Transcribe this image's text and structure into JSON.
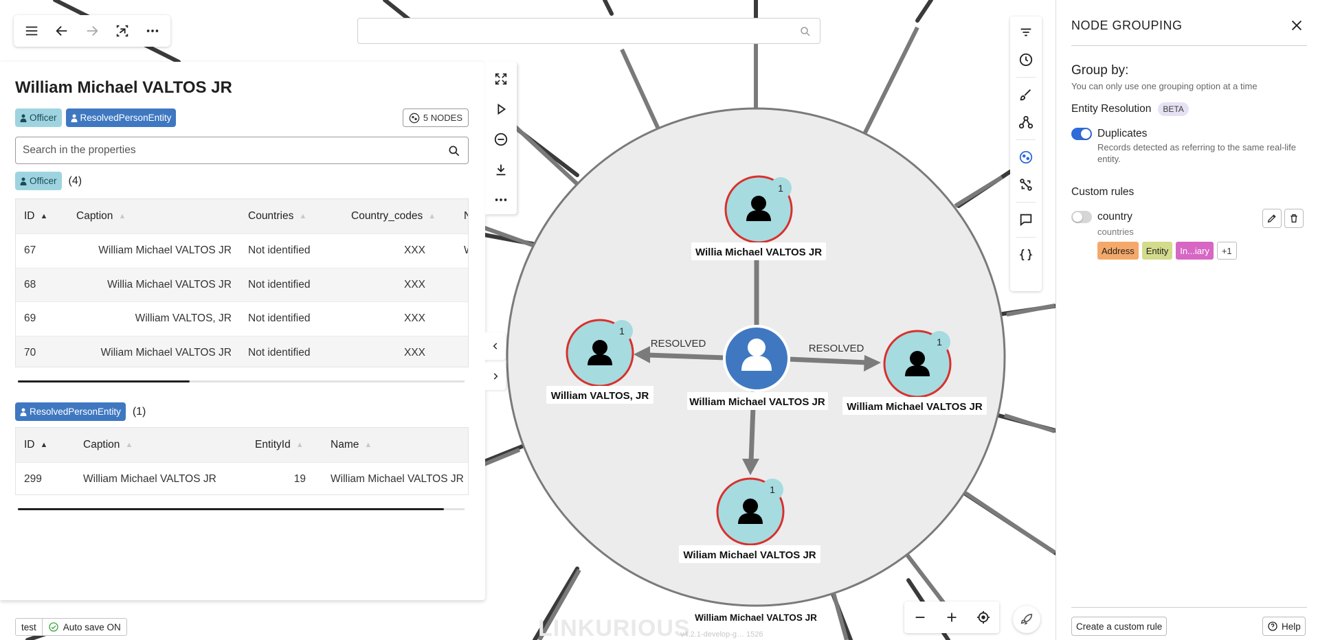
{
  "toolbar": {
    "icons": [
      "menu-icon",
      "back-arrow-icon",
      "forward-arrow-icon",
      "layout-icon",
      "more-icon"
    ]
  },
  "main_search": {
    "placeholder": ""
  },
  "left_panel": {
    "title": "William Michael VALTOS JR",
    "categories": [
      {
        "label": "Officer",
        "color": "#9ed4e0"
      },
      {
        "label": "ResolvedPersonEntity",
        "color": "#3f78c1"
      }
    ],
    "nodes_badge": "5 NODES",
    "search_placeholder": "Search in the properties",
    "officer_section": {
      "badge": "Officer",
      "count": "(4)",
      "columns": [
        "ID",
        "Caption",
        "Countries",
        "Country_codes",
        "N"
      ],
      "rows": [
        {
          "id": "67",
          "caption": "William Michael VALTOS JR",
          "countries": "Not identified",
          "country_codes": "XXX",
          "extra": "W"
        },
        {
          "id": "68",
          "caption": "Willia Michael VALTOS JR",
          "countries": "Not identified",
          "country_codes": "XXX",
          "extra": ""
        },
        {
          "id": "69",
          "caption": "William VALTOS, JR",
          "countries": "Not identified",
          "country_codes": "XXX",
          "extra": ""
        },
        {
          "id": "70",
          "caption": "Wiliam Michael VALTOS JR",
          "countries": "Not identified",
          "country_codes": "XXX",
          "extra": ""
        }
      ]
    },
    "resolved_section": {
      "badge": "ResolvedPersonEntity",
      "count": "(1)",
      "columns": [
        "ID",
        "Caption",
        "EntityId",
        "Name"
      ],
      "rows": [
        {
          "id": "299",
          "caption": "William Michael VALTOS JR",
          "entity_id": "19",
          "name": "William Michael VALTOS JR"
        }
      ]
    }
  },
  "graph": {
    "center_label": "William Michael VALTOS JR",
    "nodes": [
      {
        "label": "Willia Michael VALTOS JR",
        "badge": "1"
      },
      {
        "label": "William VALTOS, JR",
        "badge": "1"
      },
      {
        "label": "William Michael VALTOS JR",
        "badge": "1"
      },
      {
        "label": "Wiliam Michael VALTOS JR",
        "badge": "1"
      }
    ],
    "edge_labels": [
      "RESOLVED",
      "RESOLVED"
    ],
    "group_caption": "William Michael VALTOS JR",
    "node_color": "#a6dbe0",
    "center_color": "#3f78c1",
    "border_color": "#d9302c"
  },
  "right_panel": {
    "title": "NODE GROUPING",
    "group_by": "Group by:",
    "hint": "You can only use one grouping option at a time",
    "entity_resolution": "Entity Resolution",
    "beta": "BETA",
    "duplicates": {
      "label": "Duplicates",
      "desc": "Records detected as referring to the same real-life entity.",
      "enabled": true
    },
    "custom_rules_title": "Custom rules",
    "custom_rule": {
      "name": "country",
      "property": "countries",
      "enabled": false,
      "chips": [
        {
          "label": "Address",
          "color": "#f4a96a"
        },
        {
          "label": "Entity",
          "color": "#d3db8c"
        },
        {
          "label": "In...iary",
          "color": "#d767c3"
        }
      ],
      "more": "+1"
    },
    "create_button": "Create a custom rule",
    "help_button": "Help"
  },
  "status": {
    "workspace": "test",
    "autosave": "Auto save ON"
  },
  "watermark": "LINKURIOUS",
  "version": "v4.2.1-develop-g… 1526"
}
